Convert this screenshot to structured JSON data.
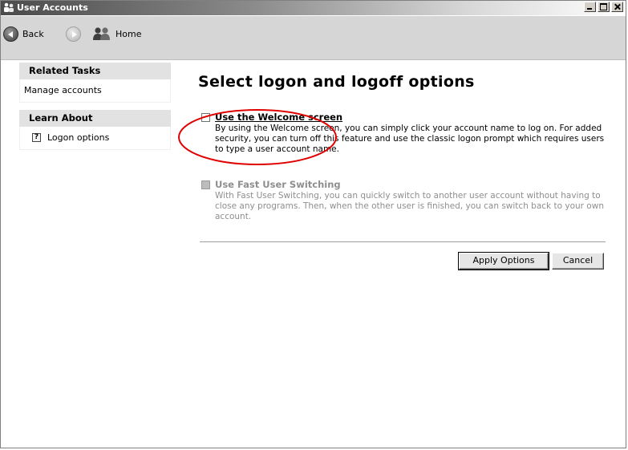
{
  "window": {
    "title": "User Accounts",
    "minimize_label": "minimize",
    "maximize_label": "maximize",
    "close_label": "close"
  },
  "toolbar": {
    "back_label": "Back",
    "home_label": "Home"
  },
  "sidebar": {
    "related_tasks": {
      "header": "Related Tasks",
      "items": [
        {
          "label": "Manage accounts"
        }
      ]
    },
    "learn_about": {
      "header": "Learn About",
      "items": [
        {
          "label": "Logon options",
          "icon": "help-icon"
        }
      ]
    }
  },
  "main": {
    "title": "Select logon and logoff options",
    "options": [
      {
        "label": "Use the Welcome screen",
        "checked": false,
        "enabled": true,
        "description": "By using the Welcome screen, you can simply click your account name to log on. For added security, you can turn off this feature and use the classic logon prompt which requires users to type a user account name."
      },
      {
        "label": "Use Fast User Switching",
        "checked": false,
        "enabled": false,
        "description": "With Fast User Switching, you can quickly switch to another user account without having to close any programs. Then, when the other user is finished, you can switch back to your own account."
      }
    ],
    "apply_label": "Apply Options",
    "cancel_label": "Cancel"
  },
  "colors": {
    "annotation": "#e00000",
    "panel_header": "#e2e2e2",
    "toolbar": "#d6d6d6"
  }
}
